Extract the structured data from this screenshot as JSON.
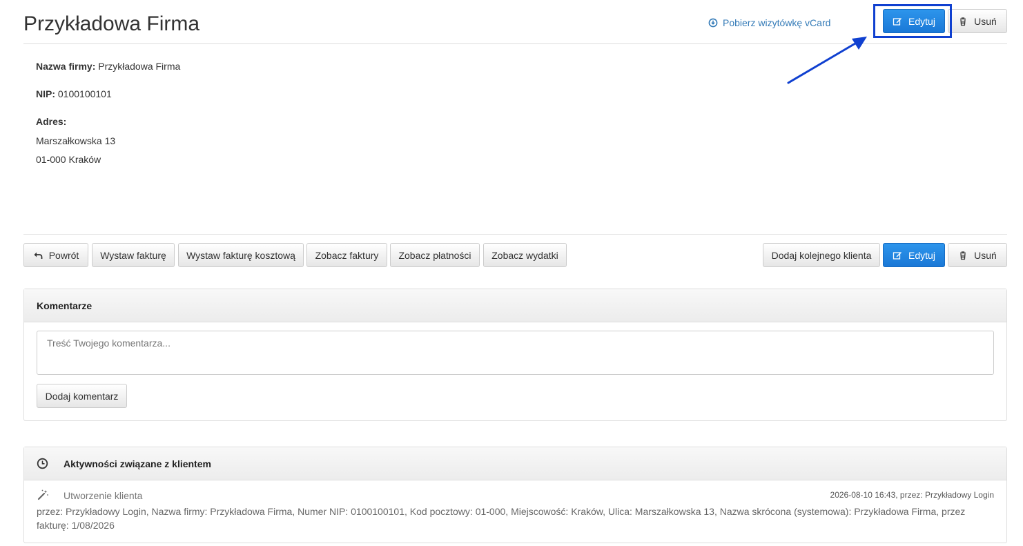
{
  "header": {
    "title": "Przykładowa Firma",
    "vcard_label": "Pobierz wizytówkę vCard",
    "edit_label": "Edytuj",
    "delete_label": "Usuń"
  },
  "info": {
    "company_label": "Nazwa firmy:",
    "company_value": "Przykładowa Firma",
    "nip_label": "NIP:",
    "nip_value": "0100100101",
    "address_label": "Adres:",
    "address_line1": "Marszałkowska 13",
    "address_line2": "01-000 Kraków"
  },
  "toolbar": {
    "back_label": "Powrót",
    "invoice_label": "Wystaw fakturę",
    "cost_invoice_label": "Wystaw fakturę kosztową",
    "view_invoices_label": "Zobacz faktury",
    "view_payments_label": "Zobacz płatności",
    "view_expenses_label": "Zobacz wydatki",
    "add_client_label": "Dodaj kolejnego klienta",
    "edit_label": "Edytuj",
    "delete_label": "Usuń"
  },
  "comments": {
    "title": "Komentarze",
    "placeholder": "Treść Twojego komentarza...",
    "add_label": "Dodaj komentarz"
  },
  "activities": {
    "title": "Aktywności związane z klientem",
    "items": [
      {
        "title": "Utworzenie klienta",
        "meta": "2026-08-10 16:43, przez: Przykładowy Login",
        "body": "przez: Przykładowy Login, Nazwa firmy: Przykładowa Firma, Numer NIP: 0100100101, Kod pocztowy: 01-000, Miejscowość: Kraków, Ulica: Marszałkowska 13, Nazwa skrócona (systemowa): Przykładowa Firma, przez fakturę: 1/08/2026"
      }
    ]
  },
  "colors": {
    "primary": "#1a78d6",
    "link": "#337ab7",
    "highlight": "#1040d0"
  }
}
